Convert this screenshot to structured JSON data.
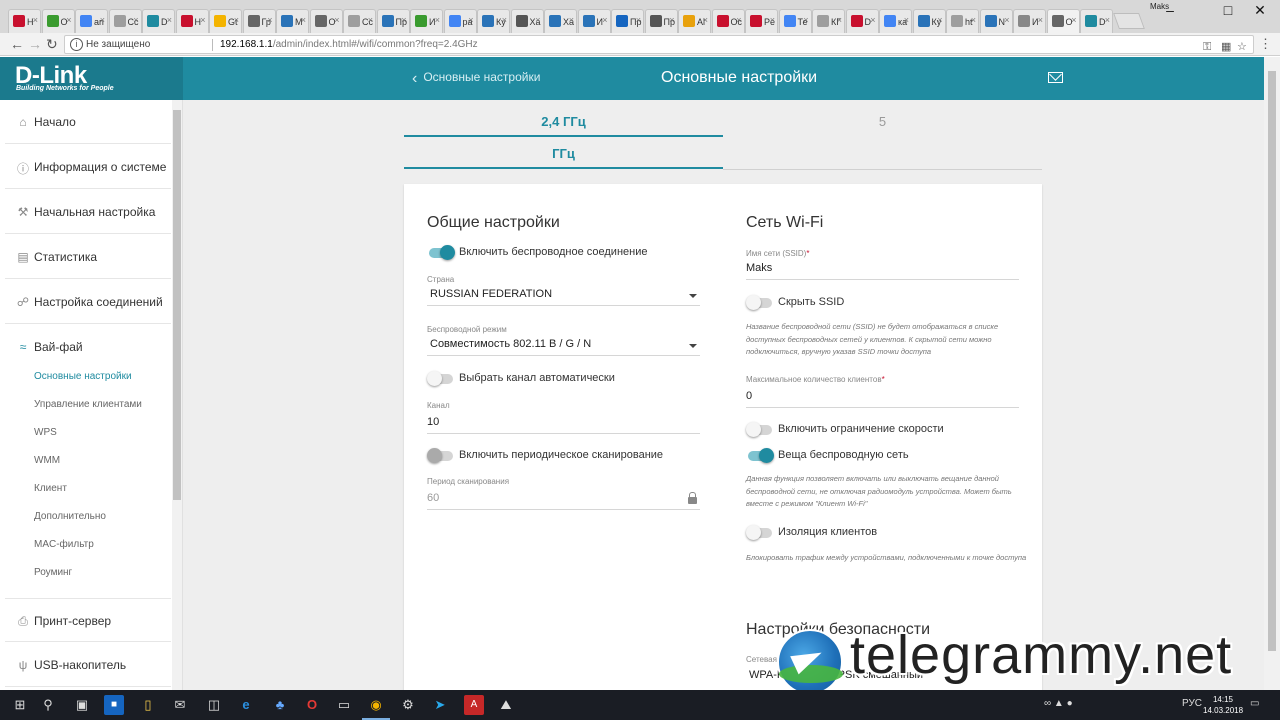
{
  "browser": {
    "tabs": [
      {
        "label": "Н",
        "icon": "h-icon",
        "color": "#c8102e"
      },
      {
        "label": "O",
        "icon": "o-icon",
        "color": "#3a9b2f"
      },
      {
        "label": "ап",
        "icon": "google-icon",
        "color": "#4285f4"
      },
      {
        "label": "Cc",
        "icon": "page-icon",
        "color": "#9e9e9e"
      },
      {
        "label": "D",
        "icon": "dlink-icon",
        "color": "#1f8ba0"
      },
      {
        "label": "Н",
        "icon": "h-icon",
        "color": "#c8102e"
      },
      {
        "label": "Gt",
        "icon": "drive-icon",
        "color": "#f4b400"
      },
      {
        "label": "Гр",
        "icon": "person-icon",
        "color": "#666666"
      },
      {
        "label": "M",
        "icon": "bird-icon",
        "color": "#2a73b8"
      },
      {
        "label": "О",
        "icon": "person-icon",
        "color": "#666666"
      },
      {
        "label": "Cc",
        "icon": "page-icon",
        "color": "#9e9e9e"
      },
      {
        "label": "Пр",
        "icon": "eye-icon",
        "color": "#2a73b8"
      },
      {
        "label": "И",
        "icon": "globe-icon",
        "color": "#3a9b2f"
      },
      {
        "label": "ра",
        "icon": "google-icon",
        "color": "#4285f4"
      },
      {
        "label": "Ку",
        "icon": "bird-icon",
        "color": "#2a73b8"
      },
      {
        "label": "Ха",
        "icon": "tool-icon",
        "color": "#555555"
      },
      {
        "label": "Ха",
        "icon": "bird-icon",
        "color": "#2a73b8"
      },
      {
        "label": "И",
        "icon": "eye-icon",
        "color": "#2a73b8"
      },
      {
        "label": "Пр",
        "icon": "p-icon",
        "color": "#1565c0"
      },
      {
        "label": "Пр",
        "icon": "link-icon",
        "color": "#555555"
      },
      {
        "label": "Al",
        "icon": "ali-icon",
        "color": "#e8a10c"
      },
      {
        "label": "Ос",
        "icon": "o-icon",
        "color": "#c8102e"
      },
      {
        "label": "Pe",
        "icon": "dots-icon",
        "color": "#c8102e"
      },
      {
        "label": "Те",
        "icon": "google-icon",
        "color": "#4285f4"
      },
      {
        "label": "КГ",
        "icon": "page-icon",
        "color": "#9e9e9e"
      },
      {
        "label": "D",
        "icon": "h-icon",
        "color": "#c8102e"
      },
      {
        "label": "ка",
        "icon": "google-icon",
        "color": "#4285f4"
      },
      {
        "label": "Ку",
        "icon": "bird-icon",
        "color": "#2a73b8"
      },
      {
        "label": "ht",
        "icon": "page-icon",
        "color": "#9e9e9e"
      },
      {
        "label": "N",
        "icon": "bird-icon",
        "color": "#2a73b8"
      },
      {
        "label": "И",
        "icon": "globe-icon",
        "color": "#888888"
      },
      {
        "label": "О",
        "icon": "person-icon",
        "color": "#666666"
      },
      {
        "label": "D",
        "icon": "dlink-icon",
        "color": "#1f8ba0"
      }
    ],
    "user": "Maks",
    "insecure_label": "Не защищено",
    "url_host": "192.168.1.1",
    "url_path": "/admin/index.html#/wifi/common?freq=2.4GHz"
  },
  "header": {
    "logo": "D-Link",
    "tagline": "Building Networks for People",
    "back_label": "Основные настройки",
    "title": "Основные настройки"
  },
  "sidebar": {
    "items": [
      {
        "label": "Начало",
        "icon": "home-icon"
      },
      {
        "label": "Информация о системе",
        "icon": "info-icon"
      },
      {
        "label": "Начальная настройка",
        "icon": "wrench-icon"
      },
      {
        "label": "Статистика",
        "icon": "bar-chart-icon"
      },
      {
        "label": "Настройка соединений",
        "icon": "connections-icon"
      },
      {
        "label": "Вай-фай",
        "icon": "wifi-icon"
      },
      {
        "label": "Принт-сервер",
        "icon": "printer-icon"
      },
      {
        "label": "USB-накопитель",
        "icon": "usb-icon"
      }
    ],
    "wifi_sub": [
      "Основные настройки",
      "Управление клиентами",
      "WPS",
      "WMM",
      "Клиент",
      "Дополнительно",
      "MAC-фильтр",
      "Роуминг"
    ]
  },
  "band_tabs": {
    "tab1_line1": "2,4 ГГц",
    "tab1_line2": "ГГц",
    "tab2_line1": "5"
  },
  "general": {
    "title": "Общие настройки",
    "enable_wireless": "Включить беспроводное соединение",
    "enable_wireless_on": true,
    "country_label": "Страна",
    "country_value": "RUSSIAN FEDERATION",
    "mode_label": "Беспроводной режим",
    "mode_value": "Совместимость 802.11 B / G / N",
    "auto_channel": "Выбрать канал автоматически",
    "auto_channel_on": false,
    "channel_label": "Канал",
    "channel_value": "10",
    "periodic_scan": "Включить периодическое сканирование",
    "periodic_scan_on": false,
    "scan_period_label": "Период сканирования",
    "scan_period_value": "60"
  },
  "wifi": {
    "title": "Сеть Wi-Fi",
    "ssid_label": "Имя сети (SSID)",
    "ssid_required": "*",
    "ssid_value": "Maks",
    "hide_ssid": "Скрыть SSID",
    "hide_ssid_on": false,
    "hide_ssid_hint": "Название беспроводной сети (SSID) не будет отображаться в списке доступных беспроводных сетей у клиентов. К скрытой сети можно подключиться, вручную указав SSID точки доступа",
    "max_clients_label": "Максимальное количество клиентов",
    "max_clients_required": "*",
    "max_clients_value": "0",
    "speed_limit": "Включить ограничение скорости",
    "speed_limit_on": false,
    "broadcast": "Веща беспроводную сеть",
    "broadcast_on": true,
    "broadcast_hint": "Данная функция позволяет включать или выключать вещание данной беспроводной сети, не отключая радиомодуль устройства. Может быть вместе с режимом \"Клиент Wi-Fi\"",
    "isolation": "Изоляция клиентов",
    "isolation_on": false,
    "isolation_hint": "Блокировать трафик между устройствами, подключенными к точке доступа"
  },
  "security": {
    "title": "Настройки безопасности",
    "auth_label": "Сетевая",
    "auth_value_left": "WPA-P",
    "auth_value_right": "-PSK смешанный"
  },
  "watermark": {
    "text": "telegrammy.net"
  },
  "taskbar": {
    "lang": "РУС",
    "time": "14:15",
    "date": "14.03.2018"
  }
}
